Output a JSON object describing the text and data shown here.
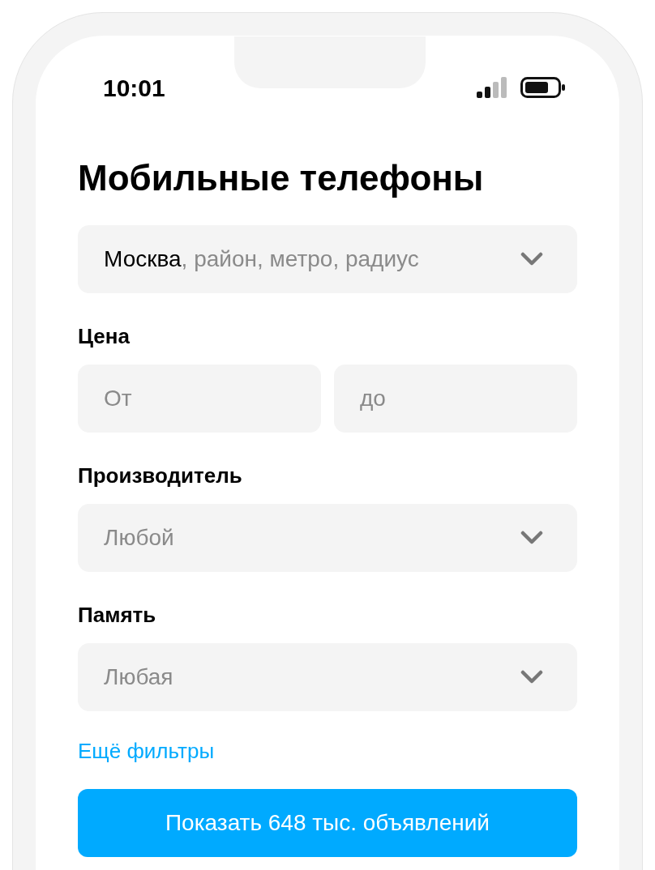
{
  "status_bar": {
    "time": "10:01"
  },
  "title": "Мобильные телефоны",
  "location": {
    "city": "Москва",
    "hint": ", район, метро, радиус"
  },
  "price": {
    "label": "Цена",
    "from": {
      "placeholder": "От"
    },
    "to": {
      "placeholder": "до"
    }
  },
  "filters": [
    {
      "label": "Производитель",
      "value": "Любой"
    },
    {
      "label": "Память",
      "value": "Любая"
    }
  ],
  "more_filters": "Ещё фильтры",
  "submit": "Показать 648 тыс. объявлений"
}
